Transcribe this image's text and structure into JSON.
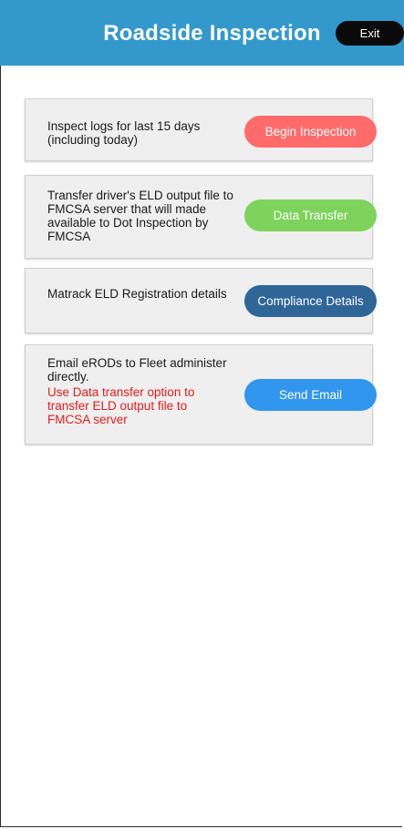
{
  "header": {
    "title": "Roadside Inspection",
    "exit_label": "Exit",
    "background_color": "#3399cc"
  },
  "cards": [
    {
      "text": "Inspect logs for last 15 days (including today)",
      "button_label": "Begin Inspection",
      "button_color": "#ff6b6b"
    },
    {
      "text": "Transfer driver's ELD output file to FMCSA server that will made available to Dot Inspection by FMCSA",
      "button_label": "Data Transfer",
      "button_color": "#7ed35c"
    },
    {
      "text": "Matrack ELD Registration details",
      "button_label": "Compliance Details",
      "button_color": "#2f6597"
    },
    {
      "text": "Email eRODs to Fleet administer directly.",
      "warning": "Use Data transfer option to transfer ELD output file to FMCSA server",
      "button_label": "Send Email",
      "button_color": "#3096ee"
    }
  ]
}
